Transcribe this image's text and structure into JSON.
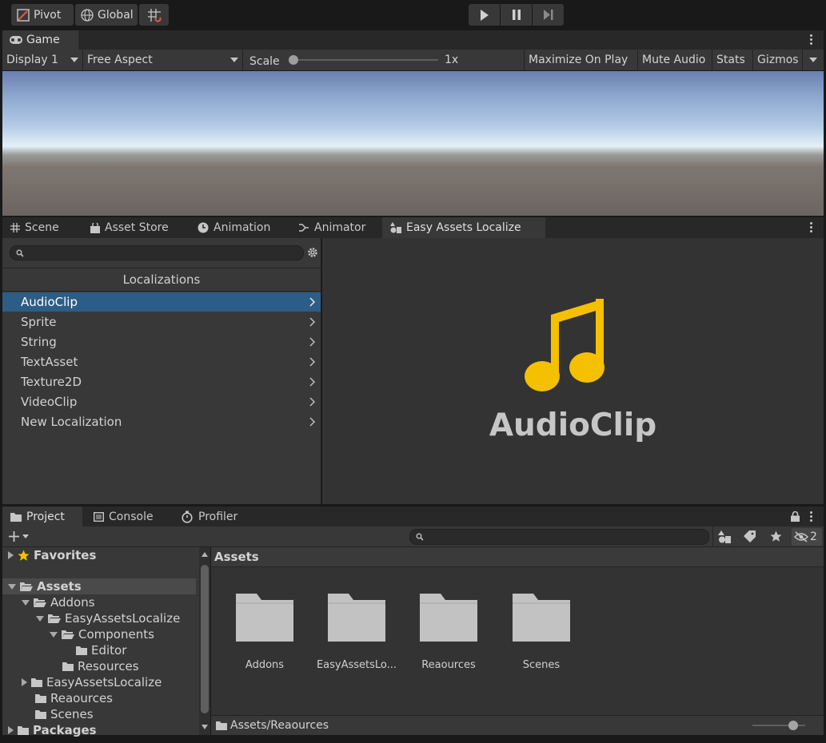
{
  "toolbar": {
    "pivot_label": "Pivot",
    "global_label": "Global",
    "icons": [
      "pivot-icon",
      "globe-icon",
      "grid-snap-icon",
      "play-icon",
      "pause-icon",
      "step-icon"
    ]
  },
  "game_panel": {
    "tab_label": "Game",
    "display_value": "Display 1",
    "aspect_value": "Free Aspect",
    "scale_label": "Scale",
    "scale_value": "1x",
    "scale_slider_fraction": 0.0,
    "maximize_label": "Maximize On Play",
    "mute_label": "Mute Audio",
    "stats_label": "Stats",
    "gizmos_label": "Gizmos"
  },
  "middle_tabs": [
    {
      "label": "Scene"
    },
    {
      "label": "Asset Store"
    },
    {
      "label": "Animation"
    },
    {
      "label": "Animator"
    },
    {
      "label": "Easy Assets Localize"
    }
  ],
  "localize": {
    "header": "Localizations",
    "items": [
      "AudioClip",
      "Sprite",
      "String",
      "TextAsset",
      "Texture2D",
      "VideoClip",
      "New Localization"
    ],
    "selected_index": 0,
    "preview_title": "AudioClip",
    "preview_icon": "music-note-icon",
    "accent_color": "#f5c000"
  },
  "bottom_tabs": [
    {
      "label": "Project"
    },
    {
      "label": "Console"
    },
    {
      "label": "Profiler"
    }
  ],
  "project": {
    "hidden_count": "2",
    "tree": {
      "favorites": "Favorites",
      "assets": "Assets",
      "addons": "Addons",
      "easy_assets_localize_inner": "EasyAssetsLocalize",
      "components": "Components",
      "editor": "Editor",
      "resources": "Resources",
      "easy_assets_localize": "EasyAssetsLocalize",
      "reaources": "Reaources",
      "scenes": "Scenes",
      "packages": "Packages"
    },
    "breadcrumb": "Assets",
    "grid_items": [
      "Addons",
      "EasyAssetsLo...",
      "Reaources",
      "Scenes"
    ],
    "status_path": "Assets/Reaources",
    "selection_color": "#2c5d87"
  }
}
